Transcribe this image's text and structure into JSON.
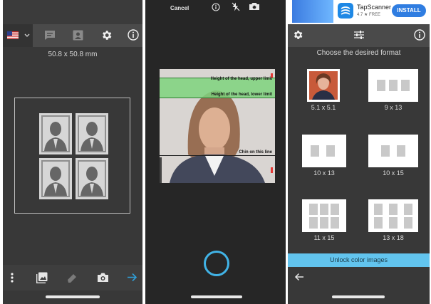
{
  "panel1": {
    "size_label": "50.8 x 50.8 mm",
    "flag": "us-flag-icon"
  },
  "panel2": {
    "cancel_label": "Cancel",
    "guide_head_upper": "Height of the head, upper limit",
    "guide_head_lower": "Height of the head, lower limit",
    "guide_chin": "Chin on this line"
  },
  "panel3": {
    "ad": {
      "app_name": "TapScanner",
      "rating": "4.7 ★ FREE",
      "install_label": "INSTALL"
    },
    "heading": "Choose the desired format",
    "formats": [
      "5.1 x 5.1",
      "9 x 13",
      "10 x 13",
      "10 x 15",
      "11 x 15",
      "13 x 18"
    ],
    "unlock_label": "Unlock color images"
  },
  "colors": {
    "panel_bg": "#383838",
    "toolbar_bg": "#4a4a4a",
    "accent_blue": "#2f9fd8",
    "unlock_bar": "#62c4ee",
    "guide_green": "#7ed37e"
  }
}
